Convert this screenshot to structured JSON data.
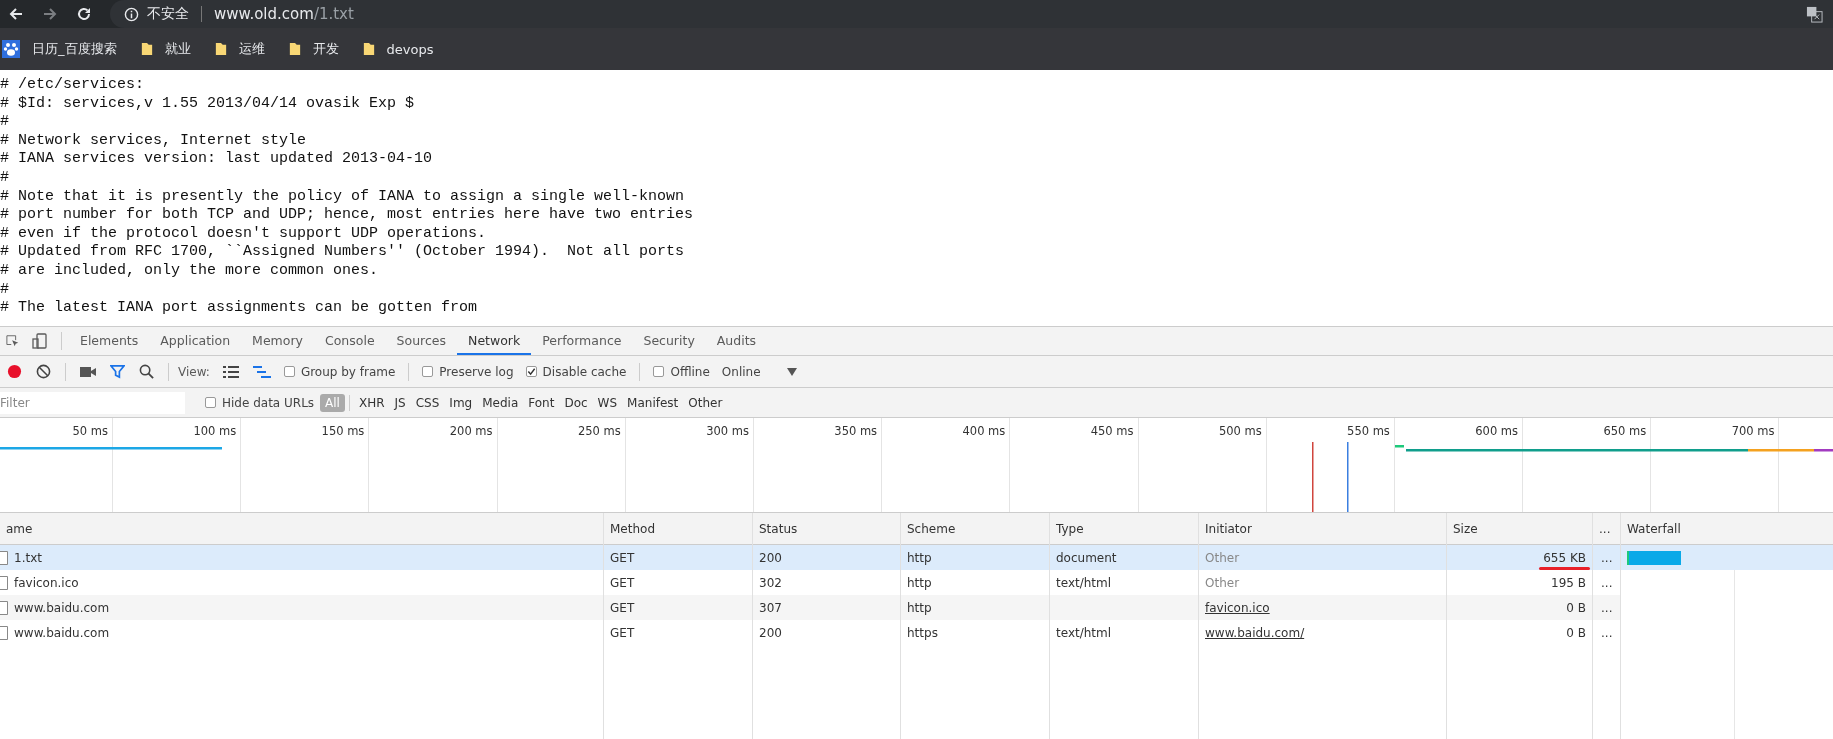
{
  "browser": {
    "address": {
      "security_label": "不安全",
      "host": "www.old.com",
      "path": "/1.txt"
    },
    "bookmarks": [
      {
        "label": "日历_百度搜索",
        "kind": "site"
      },
      {
        "label": "就业",
        "kind": "folder"
      },
      {
        "label": "运维",
        "kind": "folder"
      },
      {
        "label": "开发",
        "kind": "folder"
      },
      {
        "label": "devops",
        "kind": "folder"
      }
    ]
  },
  "page_text": [
    "# /etc/services:",
    "# $Id: services,v 1.55 2013/04/14 ovasik Exp $",
    "#",
    "# Network services, Internet style",
    "# IANA services version: last updated 2013-04-10",
    "#",
    "# Note that it is presently the policy of IANA to assign a single well-known",
    "# port number for both TCP and UDP; hence, most entries here have two entries",
    "# even if the protocol doesn't support UDP operations.",
    "# Updated from RFC 1700, ``Assigned Numbers'' (October 1994).  Not all ports",
    "# are included, only the more common ones.",
    "#",
    "# The latest IANA port assignments can be gotten from"
  ],
  "devtools": {
    "tabs": [
      {
        "label": "Elements",
        "selected": false
      },
      {
        "label": "Application",
        "selected": false
      },
      {
        "label": "Memory",
        "selected": false
      },
      {
        "label": "Console",
        "selected": false
      },
      {
        "label": "Sources",
        "selected": false
      },
      {
        "label": "Network",
        "selected": true
      },
      {
        "label": "Performance",
        "selected": false
      },
      {
        "label": "Security",
        "selected": false
      },
      {
        "label": "Audits",
        "selected": false
      }
    ],
    "toolbar": {
      "recording": true,
      "filter_active": true,
      "view_label": "View:",
      "options": [
        {
          "label": "Group by frame",
          "checked": false
        },
        {
          "label": "Preserve log",
          "checked": false
        },
        {
          "label": "Disable cache",
          "checked": true
        },
        {
          "label": "Offline",
          "checked": false
        }
      ],
      "throttling": "Online"
    },
    "filter_bar": {
      "placeholder": "Filter",
      "hide_data_urls": {
        "label": "Hide data URLs",
        "checked": false
      },
      "types": [
        {
          "label": "All",
          "selected": true
        },
        {
          "label": "XHR",
          "selected": false
        },
        {
          "label": "JS",
          "selected": false
        },
        {
          "label": "CSS",
          "selected": false
        },
        {
          "label": "Img",
          "selected": false
        },
        {
          "label": "Media",
          "selected": false
        },
        {
          "label": "Font",
          "selected": false
        },
        {
          "label": "Doc",
          "selected": false
        },
        {
          "label": "WS",
          "selected": false
        },
        {
          "label": "Manifest",
          "selected": false
        },
        {
          "label": "Other",
          "selected": false
        }
      ]
    },
    "overview": {
      "ticks": [
        "50 ms",
        "100 ms",
        "150 ms",
        "200 ms",
        "250 ms",
        "300 ms",
        "350 ms",
        "400 ms",
        "450 ms",
        "500 ms",
        "550 ms",
        "600 ms",
        "650 ms",
        "700 ms"
      ]
    },
    "table": {
      "columns": [
        "ame",
        "Method",
        "Status",
        "Scheme",
        "Type",
        "Initiator",
        "Size",
        "...",
        "Waterfall"
      ],
      "rows": [
        {
          "name": "1.txt",
          "method": "GET",
          "status": "200",
          "scheme": "http",
          "type": "document",
          "initiator": {
            "text": "Other",
            "kind": "plain"
          },
          "size": "655 KB",
          "more": "...",
          "selected": true,
          "waterfall_bar": true,
          "size_underlined": true
        },
        {
          "name": "favicon.ico",
          "method": "GET",
          "status": "302",
          "scheme": "http",
          "type": "text/html",
          "initiator": {
            "text": "Other",
            "kind": "plain"
          },
          "size": "195 B",
          "more": "...",
          "selected": false,
          "waterfall_bar": false,
          "size_underlined": false
        },
        {
          "name": "www.baidu.com",
          "method": "GET",
          "status": "307",
          "scheme": "http",
          "initiator": {
            "text": "favicon.ico",
            "kind": "link"
          },
          "size": "0 B",
          "more": "...",
          "selected": false,
          "waterfall_bar": false,
          "size_underlined": false
        },
        {
          "name": "www.baidu.com",
          "method": "GET",
          "status": "200",
          "scheme": "https",
          "type": "text/html",
          "initiator": {
            "text": "www.baidu.com/",
            "kind": "link"
          },
          "size": "0 B",
          "more": "...",
          "selected": false,
          "waterfall_bar": false,
          "size_underlined": false
        }
      ]
    }
  }
}
